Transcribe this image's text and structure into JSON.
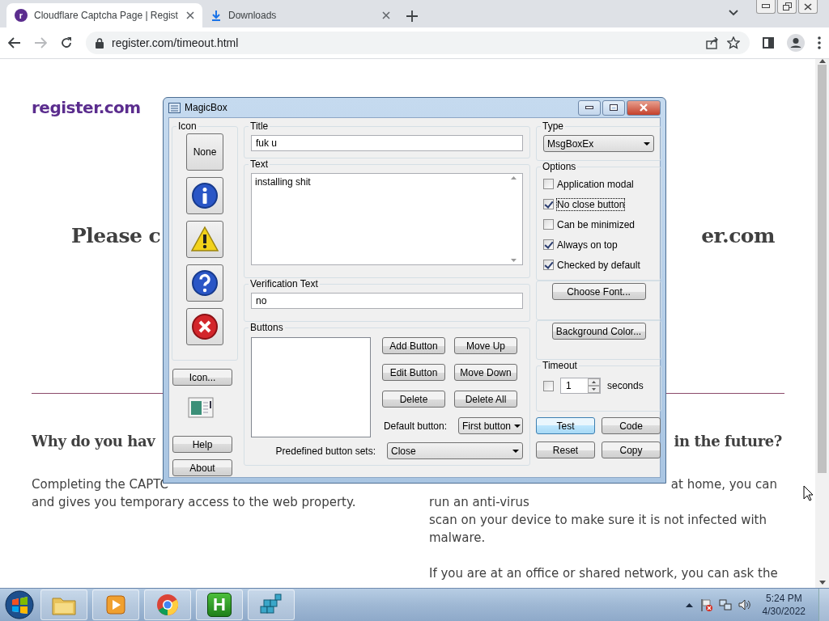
{
  "browser": {
    "tabs": [
      {
        "title": "Cloudflare Captcha Page | Regist",
        "favicon": "r",
        "kind": "site",
        "selected": true
      },
      {
        "title": "Downloads",
        "kind": "download",
        "selected": false
      }
    ],
    "address": "register.com/timeout.html"
  },
  "page": {
    "logo": "register.com",
    "heading_left": "Please c",
    "heading_right": "er.com",
    "section_left": {
      "heading": "Why do you hav",
      "lines": [
        "Completing the CAPTC",
        "and gives you temporary access to the web property."
      ]
    },
    "section_right": {
      "heading": "in the future?",
      "lines": [
        "at home, you can",
        "run an anti-virus",
        "scan on your device to make sure it is not infected with",
        "malware.",
        "If you are at an office or shared network, you can ask the"
      ]
    }
  },
  "dialog": {
    "title": "MagicBox",
    "icon_group": {
      "label": "Icon",
      "options": [
        {
          "kind": "none",
          "label": "None"
        },
        {
          "kind": "info"
        },
        {
          "kind": "warning"
        },
        {
          "kind": "question"
        },
        {
          "kind": "error"
        }
      ]
    },
    "icon_button": "Icon...",
    "help_button": "Help",
    "about_button": "About",
    "title_field": {
      "label": "Title",
      "value": "fuk u"
    },
    "text_field": {
      "label": "Text",
      "value": "installing shit"
    },
    "verification_field": {
      "label": "Verification Text",
      "value": "no"
    },
    "buttons_group": {
      "label": "Buttons",
      "actions": [
        "Add Button",
        "Move Up",
        "Edit Button",
        "Move Down",
        "Delete",
        "Delete All"
      ],
      "default_label": "Default button:",
      "default_value": "First button",
      "predefined_label": "Predefined button sets:",
      "predefined_value": "Close"
    },
    "type": {
      "label": "Type",
      "value": "MsgBoxEx"
    },
    "options": {
      "label": "Options",
      "items": [
        {
          "label": "Application modal",
          "checked": false,
          "focused": false
        },
        {
          "label": "No close button",
          "checked": true,
          "focused": true
        },
        {
          "label": "Can be minimized",
          "checked": false,
          "focused": false
        },
        {
          "label": "Always on top",
          "checked": true,
          "focused": false
        },
        {
          "label": "Checked by default",
          "checked": true,
          "focused": false
        }
      ]
    },
    "font_button": "Choose Font...",
    "color_button": "Background Color...",
    "timeout": {
      "label": "Timeout",
      "checked": false,
      "value": "1",
      "unit": "seconds"
    },
    "commands": [
      {
        "label": "Test",
        "default": true
      },
      {
        "label": "Code",
        "default": false
      },
      {
        "label": "Reset",
        "default": false
      },
      {
        "label": "Copy",
        "default": false
      }
    ]
  },
  "taskbar": {
    "apps": [
      {
        "kind": "folder"
      },
      {
        "kind": "media"
      },
      {
        "kind": "browser"
      },
      {
        "kind": "letter",
        "label": "H"
      },
      {
        "kind": "cubes"
      }
    ],
    "time": "5:24 PM",
    "date": "4/30/2022"
  }
}
